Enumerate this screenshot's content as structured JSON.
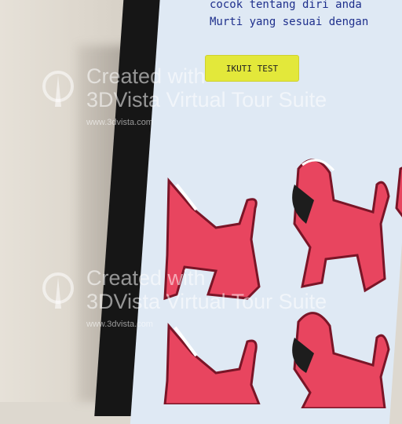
{
  "screen": {
    "text_lines": [
      "cocok  tentang diri anda",
      "Murti yang sesuai dengan"
    ],
    "button_label": "IKUTI TEST"
  },
  "watermark": {
    "line1": "Created with",
    "line2": "3DVista Virtual Tour Suite",
    "url": "www.3dvista.com"
  },
  "colors": {
    "wall": "#ddd8cf",
    "bezel": "#161616",
    "screen_bg": "#dfe9f4",
    "text": "#1e2f8c",
    "button": "#e3e83a",
    "lion_red": "#e8455f"
  }
}
